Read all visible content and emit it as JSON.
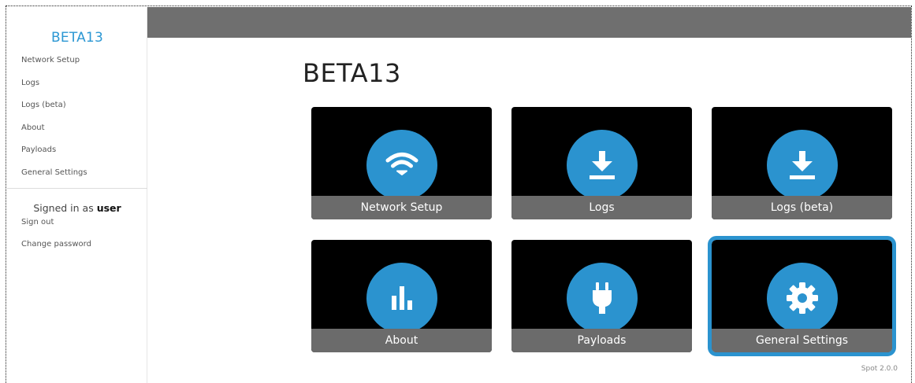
{
  "app": {
    "name": "BETA13",
    "version": "Spot 2.0.0"
  },
  "sidebar": {
    "brand": "BETA13",
    "items": [
      {
        "label": "Network Setup"
      },
      {
        "label": "Logs"
      },
      {
        "label": "Logs (beta)"
      },
      {
        "label": "About"
      },
      {
        "label": "Payloads"
      },
      {
        "label": "General Settings"
      }
    ],
    "signed_in_prefix": "Signed in as",
    "signed_in_user": "user",
    "account_items": [
      {
        "label": "Sign out"
      },
      {
        "label": "Change password"
      }
    ]
  },
  "main": {
    "title": "BETA13",
    "tiles": [
      {
        "label": "Network Setup",
        "icon": "wifi-icon"
      },
      {
        "label": "Logs",
        "icon": "download-icon"
      },
      {
        "label": "Logs (beta)",
        "icon": "download-icon"
      },
      {
        "label": "About",
        "icon": "bar-chart-icon"
      },
      {
        "label": "Payloads",
        "icon": "plug-icon"
      },
      {
        "label": "General Settings",
        "icon": "gear-icon",
        "selected": true
      }
    ]
  },
  "colors": {
    "accent": "#2b93cf",
    "topbar": "#6f6f6f",
    "tile_bg": "#000000",
    "tile_caption_bg": "#6b6b6b"
  }
}
